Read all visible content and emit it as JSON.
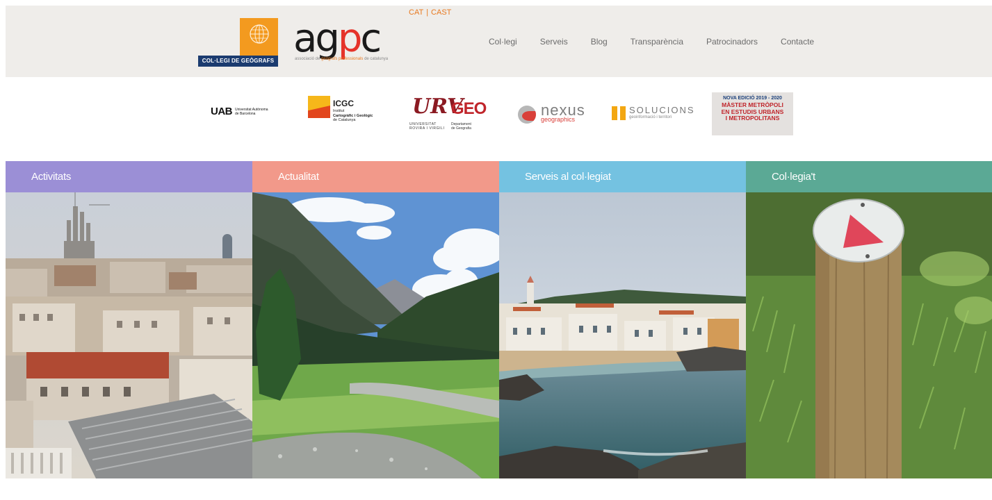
{
  "header": {
    "languages": [
      "CAT",
      "CAST"
    ],
    "language_separator": "|",
    "cdg_logo_text": "COL·LEGI DE GEÒGRAFS",
    "agpc_logo": {
      "word_prefix": "ag",
      "word_accent": "p",
      "word_suffix": "c",
      "tagline_pre": "associació de ",
      "tagline_em": "geògrafs professionals",
      "tagline_post": " de catalunya"
    },
    "nav": [
      "Col·legi",
      "Serveis",
      "Blog",
      "Transparència",
      "Patrocinadors",
      "Contacte"
    ],
    "background": "#efedea",
    "accent_color": "#e8791f"
  },
  "sponsors": {
    "uab": {
      "mark": "UAB",
      "text_line1": "Universitat Autònoma",
      "text_line2": "de Barcelona"
    },
    "icgc": {
      "title": "ICGC",
      "line1": "Institut",
      "line2": "Cartogràfic i Geològic",
      "line3": "de Catalunya"
    },
    "urv": {
      "mark": "URV",
      "geo": "GEO",
      "univ_line1": "UNIVERSITAT",
      "univ_line2": "ROVIRA I VIRGILI",
      "dept_line1": "Departament",
      "dept_line2": "de Geografia"
    },
    "nexus": {
      "title": "nexus",
      "subtitle": "geographics"
    },
    "solucions": {
      "title": "SOLUCIONS",
      "subtitle": "geoinformació i territori"
    },
    "master": {
      "edition": "NOVA EDICIÓ 2019 - 2020",
      "line1": "MÀSTER METRÒPOLI",
      "line2": "EN ESTUDIS URBANS",
      "line3": "I METROPOLITANS"
    }
  },
  "tiles": [
    {
      "title": "Activitats",
      "color": "#9b8fd6",
      "image": "barcelona-rooftops"
    },
    {
      "title": "Actualitat",
      "color": "#f2998a",
      "image": "mountain-valley-stream"
    },
    {
      "title": "Serveis al col·legiat",
      "color": "#74c2e1",
      "image": "coastal-village-bay"
    },
    {
      "title": "Col·legia't",
      "color": "#5ba995",
      "image": "trail-marker-post"
    }
  ]
}
